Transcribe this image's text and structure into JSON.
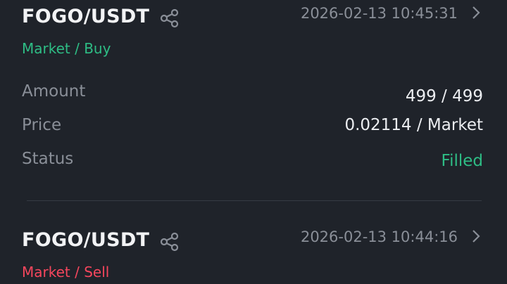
{
  "orders": [
    {
      "pair": "FOGO/USDT",
      "datetime": "2026-02-13 10:45:31",
      "order_type": "Market / Buy",
      "amount_label": "Amount",
      "amount_value": "499 / 499",
      "price_label": "Price",
      "price_value": "0.02114 / Market",
      "status_label": "Status",
      "status_value": "Filled"
    },
    {
      "pair": "FOGO/USDT",
      "datetime": "2026-02-13 10:44:16",
      "order_type": "Market / Sell"
    }
  ],
  "icons": {
    "share": "share-icon",
    "chevron": "chevron-right-icon"
  },
  "colors": {
    "background": "#1f232a",
    "buy": "#2ebd85",
    "sell": "#f6465d",
    "muted": "#8a8f98",
    "text": "#f2f3f5"
  }
}
